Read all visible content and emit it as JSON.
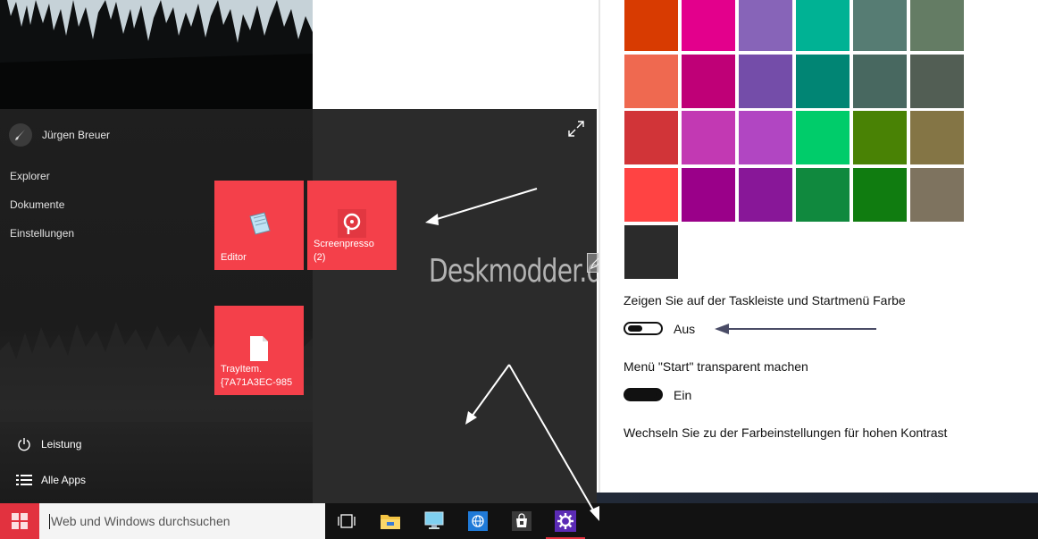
{
  "start_menu": {
    "user_name": "Jürgen Breuer",
    "links": [
      "Explorer",
      "Dokumente",
      "Einstellungen"
    ],
    "power_label": "Leistung",
    "all_apps_label": "Alle Apps",
    "tiles": [
      {
        "label": "Editor",
        "icon": "notepad-icon"
      },
      {
        "label_line1": "Screenpresso",
        "label_line2": "(2)",
        "icon": "screenpresso-icon"
      },
      {
        "label_line1": "TrayItem.",
        "label_line2": "{7A71A3EC-985",
        "icon": "document-icon"
      }
    ],
    "tile_color": "#f4404a",
    "watermark": "Deskmodder.de"
  },
  "settings": {
    "swatch_colors": [
      [
        "#d83b01",
        "#e3008c",
        "#8764b8",
        "#00b294",
        "#567c73",
        "#647c64"
      ],
      [
        "#ef6950",
        "#bf0077",
        "#744da9",
        "#018574",
        "#486860",
        "#525e54"
      ],
      [
        "#d13438",
        "#c239b3",
        "#b146c2",
        "#00cc6a",
        "#498205",
        "#847545"
      ],
      [
        "#ff4343",
        "#9a0089",
        "#881798",
        "#10893e",
        "#107c10",
        "#7e735f"
      ],
      [
        "#2b2b2b"
      ]
    ],
    "color_taskbar_label": "Zeigen Sie auf der Taskleiste und Startmenü Farbe",
    "color_taskbar_state": "Aus",
    "transparent_label": "Menü \"Start\" transparent machen",
    "transparent_state": "Ein",
    "high_contrast_link": "Wechseln Sie zu der Farbeinstellungen für hohen Kontrast"
  },
  "taskbar": {
    "search_placeholder": "Web und Windows durchsuchen",
    "accent": "#e2323f",
    "icons": [
      "task-view-icon",
      "file-explorer-icon",
      "computer-icon",
      "browser-icon",
      "store-icon",
      "settings-icon"
    ]
  }
}
